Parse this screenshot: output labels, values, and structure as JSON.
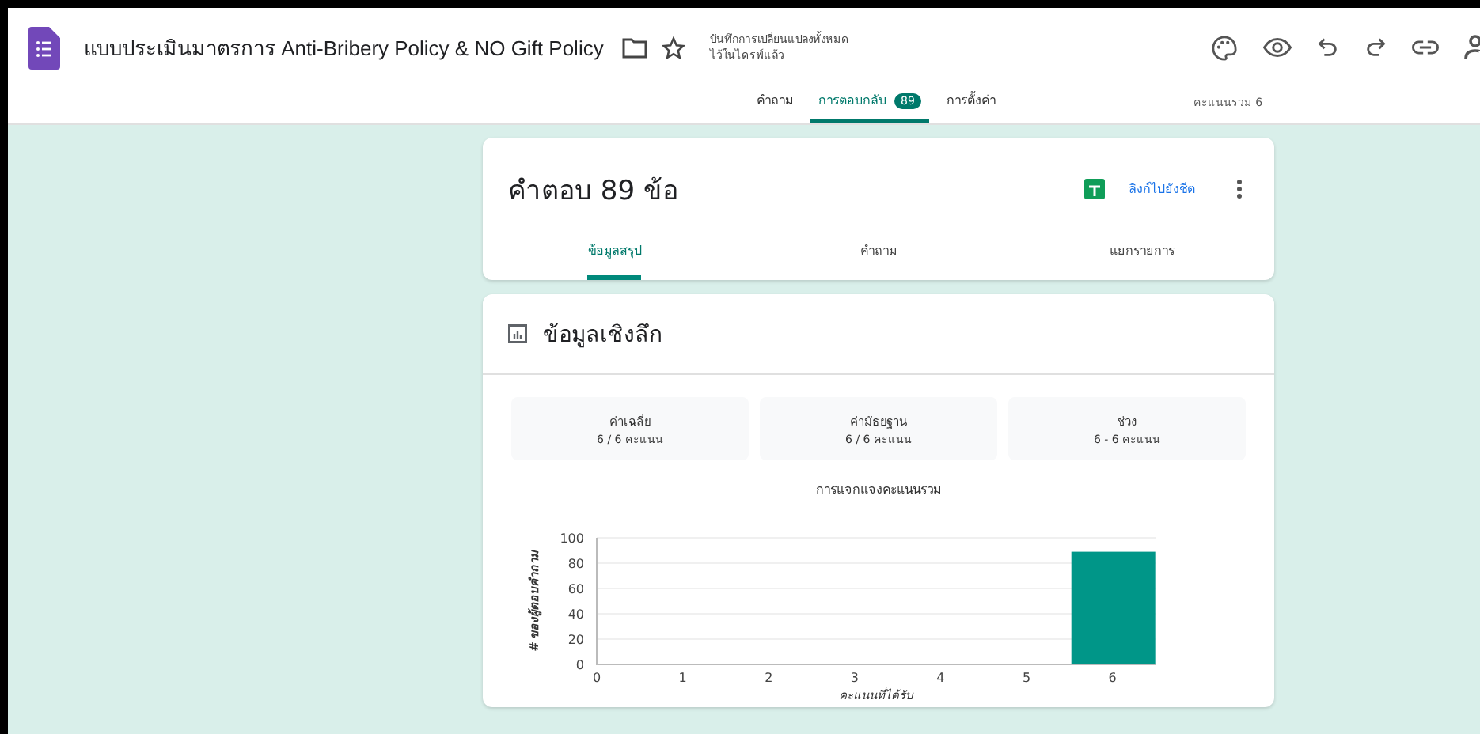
{
  "header": {
    "title": "แบบประเมินมาตรการ Anti-Bribery Policy & NO Gift Policy",
    "save_status": [
      "บันทึกการเปลี่ยนแปลงทั้งหมด",
      "ไว้ในไดรฟ์แล้ว"
    ]
  },
  "tabs": [
    {
      "label": "คำถาม",
      "selected": false
    },
    {
      "label": "การตอบกลับ",
      "selected": true,
      "badge": "89"
    },
    {
      "label": "การตั้งค่า",
      "selected": false
    }
  ],
  "total_points": "คะแนนรวม 6",
  "responses_card": {
    "title": "คำตอบ 89 ข้อ",
    "sheet_link": "ลิงก์ไปยังชีต",
    "tabs": [
      {
        "label": "ข้อมูลสรุป",
        "selected": true
      },
      {
        "label": "คำถาม",
        "selected": false
      },
      {
        "label": "แยกรายการ",
        "selected": false
      }
    ]
  },
  "insights": {
    "title": "ข้อมูลเชิงลึก",
    "stats": [
      {
        "label": "ค่าเฉลี่ย",
        "value": "6 / 6 คะแนน"
      },
      {
        "label": "ค่ามัธยฐาน",
        "value": "6 / 6 คะแนน"
      },
      {
        "label": "ช่วง",
        "value": "6 - 6 คะแนน"
      }
    ],
    "chart_data": {
      "type": "bar",
      "title": "การแจกแจงคะแนนรวม",
      "xlabel": "คะแนนที่ได้รับ",
      "ylabel": "# ของผู้ตอบคำถาม",
      "categories": [
        "0",
        "1",
        "2",
        "3",
        "4",
        "5",
        "6"
      ],
      "values": [
        0,
        0,
        0,
        0,
        0,
        0,
        89
      ],
      "ylim": [
        0,
        100
      ],
      "yticks": [
        0,
        20,
        40,
        60,
        80,
        100
      ],
      "grid": true
    }
  }
}
